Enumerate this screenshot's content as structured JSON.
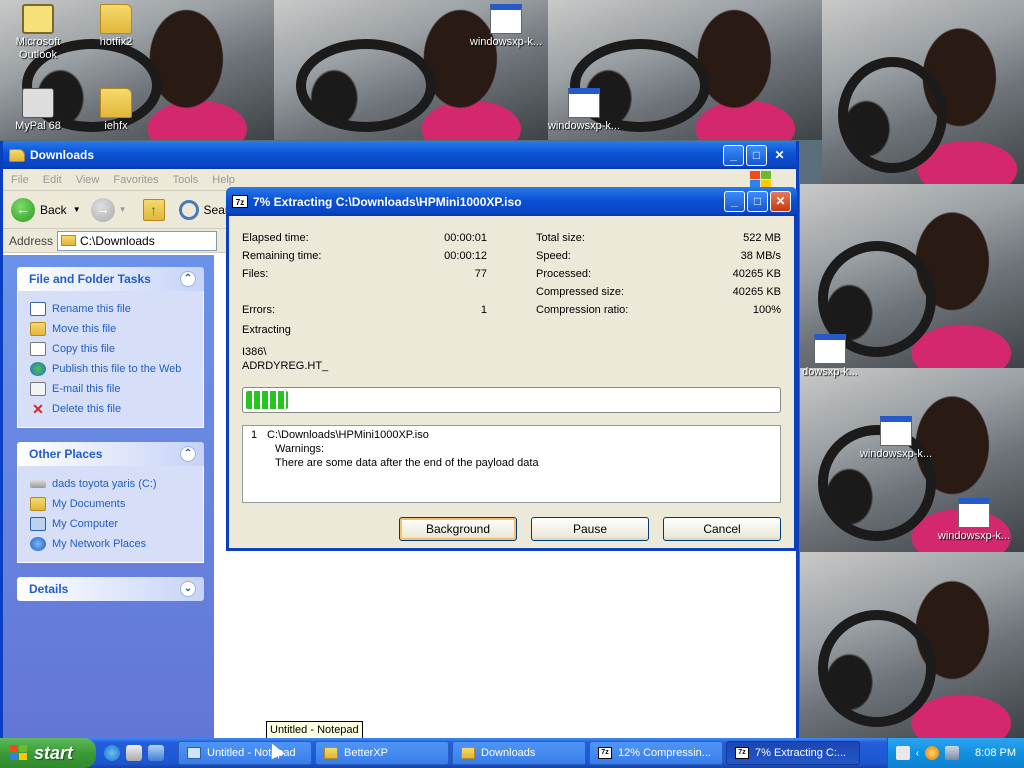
{
  "desktop": {
    "icons": [
      {
        "label": "Microsoft Outlook",
        "name": "desktop-icon-outlook"
      },
      {
        "label": "hotfix2",
        "name": "desktop-icon-hotfix2"
      },
      {
        "label": "windowsxp-k...",
        "name": "desktop-icon-windowsxp-1"
      },
      {
        "label": "MyPal 68",
        "name": "desktop-icon-mypal"
      },
      {
        "label": "iehfx",
        "name": "desktop-icon-iehfx"
      },
      {
        "label": "windowsxp-k...",
        "name": "desktop-icon-windowsxp-2"
      },
      {
        "label": "dowsxp-k...",
        "name": "desktop-icon-windowsxp-3"
      },
      {
        "label": "windowsxp-k...",
        "name": "desktop-icon-windowsxp-4"
      },
      {
        "label": "windowsxp-k...",
        "name": "desktop-icon-windowsxp-5"
      }
    ]
  },
  "explorer": {
    "title": "Downloads",
    "menu": [
      "File",
      "Edit",
      "View",
      "Favorites",
      "Tools",
      "Help"
    ],
    "toolbar": {
      "back": "Back",
      "search": "Searc"
    },
    "address": {
      "label": "Address",
      "value": "C:\\Downloads"
    },
    "tasks": {
      "file_folder_title": "File and Folder Tasks",
      "file_folder_items": [
        "Rename this file",
        "Move this file",
        "Copy this file",
        "Publish this file to the Web",
        "E-mail this file",
        "Delete this file"
      ],
      "other_places_title": "Other Places",
      "other_places_items": [
        "dads toyota yaris (C:)",
        "My Documents",
        "My Computer",
        "My Network Places"
      ],
      "details_title": "Details"
    }
  },
  "dialog": {
    "title": "7% Extracting C:\\Downloads\\HPMini1000XP.iso",
    "progress_fraction": 0.08,
    "left_stats": {
      "elapsed_label": "Elapsed time:",
      "elapsed_value": "00:00:01",
      "remaining_label": "Remaining time:",
      "remaining_value": "00:00:12",
      "files_label": "Files:",
      "files_value": "77",
      "errors_label": "Errors:",
      "errors_value": "1"
    },
    "right_stats": {
      "total_label": "Total size:",
      "total_value": "522 MB",
      "speed_label": "Speed:",
      "speed_value": "38 MB/s",
      "processed_label": "Processed:",
      "processed_value": "40265 KB",
      "compressed_label": "Compressed size:",
      "compressed_value": "40265 KB",
      "ratio_label": "Compression ratio:",
      "ratio_value": "100%"
    },
    "status": "Extracting",
    "current_dir": "I386\\",
    "current_file": "ADRDYREG.HT_",
    "log": {
      "num": "1",
      "path": "C:\\Downloads\\HPMini1000XP.iso",
      "warnings": "Warnings:",
      "message": "There are some data after the end of the payload data"
    },
    "buttons": {
      "background": "Background",
      "pause": "Pause",
      "cancel": "Cancel"
    }
  },
  "tooltip": "Untitled - Notepad",
  "taskbar": {
    "start": "start",
    "tasks": [
      {
        "label": "Untitled - Notepad",
        "icon": "notepad-icon"
      },
      {
        "label": "BetterXP",
        "icon": "folder-icon"
      },
      {
        "label": "Downloads",
        "icon": "folder-icon"
      },
      {
        "label": "12% Compressin...",
        "icon": "7zip-icon"
      },
      {
        "label": "7% Extracting C:...",
        "icon": "7zip-icon"
      }
    ],
    "clock": "8:08 PM"
  },
  "colors": {
    "title_blue": "#0a52d6",
    "taskpane_blue": "#6b92e8",
    "progress_green": "#29c322",
    "start_green": "#3c9b37",
    "tray_blue": "#1291e1"
  }
}
